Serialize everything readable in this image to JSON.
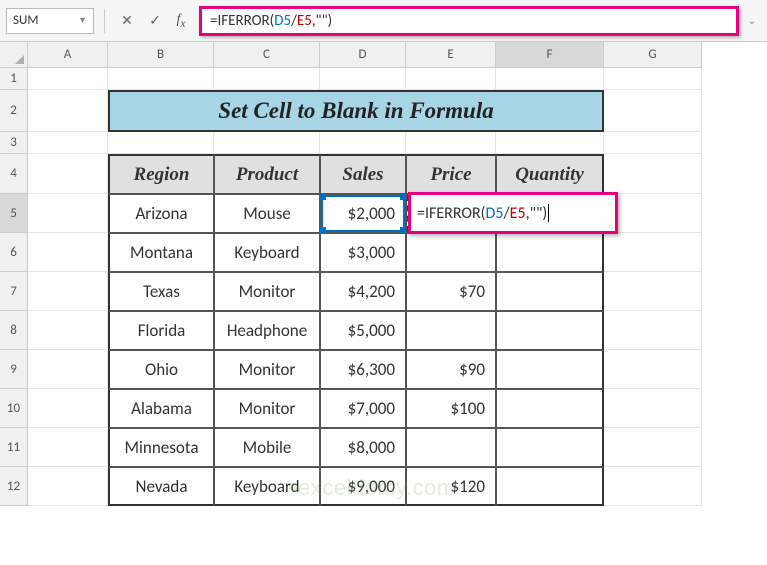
{
  "name_box": "SUM",
  "formula": {
    "prefix": "=IFERROR(",
    "ref1": "D5",
    "sep1": "/",
    "ref2": "E5",
    "suffix": ",\"\")"
  },
  "columns": [
    "A",
    "B",
    "C",
    "D",
    "E",
    "F",
    "G"
  ],
  "rows": [
    "1",
    "2",
    "3",
    "4",
    "5",
    "6",
    "7",
    "8",
    "9",
    "10",
    "11",
    "12"
  ],
  "title": "Set Cell to Blank in Formula",
  "headers": {
    "region": "Region",
    "product": "Product",
    "sales": "Sales",
    "price": "Price",
    "quantity": "Quantity"
  },
  "data": [
    {
      "region": "Arizona",
      "product": "Mouse",
      "sales": "$2,000",
      "price": ""
    },
    {
      "region": "Montana",
      "product": "Keyboard",
      "sales": "$3,000",
      "price": ""
    },
    {
      "region": "Texas",
      "product": "Monitor",
      "sales": "$4,200",
      "price": "$70"
    },
    {
      "region": "Florida",
      "product": "Headphone",
      "sales": "$5,000",
      "price": ""
    },
    {
      "region": "Ohio",
      "product": "Monitor",
      "sales": "$6,300",
      "price": "$90"
    },
    {
      "region": "Alabama",
      "product": "Monitor",
      "sales": "$7,000",
      "price": "$100"
    },
    {
      "region": "Minnesota",
      "product": "Mobile",
      "sales": "$8,000",
      "price": ""
    },
    {
      "region": "Nevada",
      "product": "Keyboard",
      "sales": "$9,000",
      "price": "$120"
    }
  ],
  "watermark": "exceldemy.com",
  "active_cell": "F5",
  "active_row": "5",
  "active_col": "F"
}
